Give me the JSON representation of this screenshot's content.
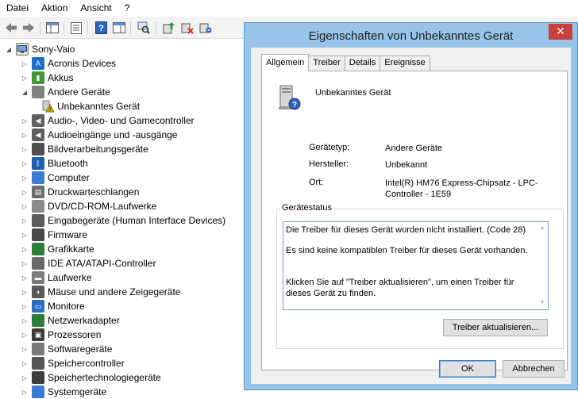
{
  "menubar": [
    "Datei",
    "Aktion",
    "Ansicht",
    "?"
  ],
  "toolbar": {
    "icons": [
      "back-arrow-icon",
      "forward-arrow-icon",
      "show-hide-tree-icon",
      "properties-icon",
      "help-icon",
      "action-pane-icon",
      "scan-hardware-icon",
      "update-driver-icon",
      "disable-device-icon",
      "uninstall-device-icon"
    ]
  },
  "tree": {
    "root": "Sony-Vaio",
    "items": [
      {
        "label": "Acronis Devices",
        "icon": "acronis-icon",
        "color": "#1f6fc8"
      },
      {
        "label": "Akkus",
        "icon": "battery-icon",
        "color": "#3d9b35"
      },
      {
        "label": "Andere Geräte",
        "icon": "other-devices-icon",
        "color": "#7f7f7f",
        "expanded": true
      },
      {
        "label": "Unbekanntes Gerät",
        "icon": "unknown-device-warning-icon",
        "color": "#e0b400",
        "child": true
      },
      {
        "label": "Audio-, Video- und Gamecontroller",
        "icon": "speaker-icon",
        "color": "#606060"
      },
      {
        "label": "Audioeingänge und -ausgänge",
        "icon": "speaker-icon",
        "color": "#606060"
      },
      {
        "label": "Bildverarbeitungsgeräte",
        "icon": "camera-icon",
        "color": "#505050"
      },
      {
        "label": "Bluetooth",
        "icon": "bluetooth-icon",
        "color": "#1a5fb4"
      },
      {
        "label": "Computer",
        "icon": "computer-icon",
        "color": "#3a7bd5"
      },
      {
        "label": "Druckwarteschlangen",
        "icon": "printer-icon",
        "color": "#6b6b6b"
      },
      {
        "label": "DVD/CD-ROM-Laufwerke",
        "icon": "disc-drive-icon",
        "color": "#8a8a8a"
      },
      {
        "label": "Eingabegeräte (Human Interface Devices)",
        "icon": "hid-icon",
        "color": "#5b5b5b"
      },
      {
        "label": "Firmware",
        "icon": "firmware-icon",
        "color": "#4a4a4a"
      },
      {
        "label": "Grafikkarte",
        "icon": "display-adapter-icon",
        "color": "#2f7d3a"
      },
      {
        "label": "IDE ATA/ATAPI-Controller",
        "icon": "ide-controller-icon",
        "color": "#6a6a6a"
      },
      {
        "label": "Laufwerke",
        "icon": "hard-drive-icon",
        "color": "#7a7a7a"
      },
      {
        "label": "Mäuse und andere Zeigegeräte",
        "icon": "mouse-icon",
        "color": "#5a5a5a"
      },
      {
        "label": "Monitore",
        "icon": "monitor-icon",
        "color": "#2b6fc0"
      },
      {
        "label": "Netzwerkadapter",
        "icon": "network-adapter-icon",
        "color": "#2f7d3a"
      },
      {
        "label": "Prozessoren",
        "icon": "processor-icon",
        "color": "#3b3b3b"
      },
      {
        "label": "Softwaregeräte",
        "icon": "software-device-icon",
        "color": "#7a7a7a"
      },
      {
        "label": "Speichercontroller",
        "icon": "storage-controller-icon",
        "color": "#555555"
      },
      {
        "label": "Speichertechnologiegeräte",
        "icon": "memory-tech-icon",
        "color": "#3d3d3d"
      },
      {
        "label": "Systemgeräte",
        "icon": "system-device-icon",
        "color": "#3a7bd5"
      }
    ]
  },
  "dialog": {
    "title": "Eigenschaften von Unbekanntes Gerät",
    "tabs": [
      "Allgemein",
      "Treiber",
      "Details",
      "Ereignisse"
    ],
    "device_name": "Unbekanntes Gerät",
    "properties": {
      "type_label": "Gerätetyp:",
      "type_value": "Andere Geräte",
      "manufacturer_label": "Hersteller:",
      "manufacturer_value": "Unbekannt",
      "location_label": "Ort:",
      "location_value": "Intel(R) HM76 Express-Chipsatz - LPC-Controller - 1E59"
    },
    "status": {
      "legend": "Gerätestatus",
      "line1": "Die Treiber für dieses Gerät wurden nicht installiert. (Code 28)",
      "line2": "Es sind keine kompatiblen Treiber für dieses Gerät vorhanden.",
      "line3": "Klicken Sie auf \"Treiber aktualisieren\", um einen Treiber für dieses Gerät zu finden."
    },
    "update_driver_button": "Treiber aktualisieren...",
    "ok_button": "OK",
    "cancel_button": "Abbrechen"
  }
}
